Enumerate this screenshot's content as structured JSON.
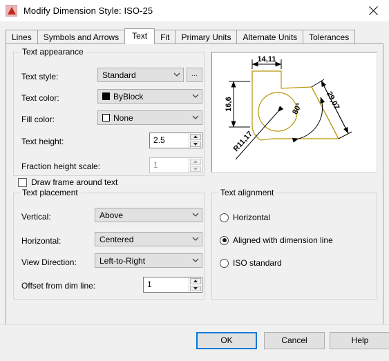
{
  "window": {
    "title": "Modify Dimension Style: ISO-25",
    "icon": "autocad-logo-icon",
    "close_label": "✕"
  },
  "tabs": [
    {
      "label": "Lines",
      "active": false
    },
    {
      "label": "Symbols and Arrows",
      "active": false
    },
    {
      "label": "Text",
      "active": true
    },
    {
      "label": "Fit",
      "active": false
    },
    {
      "label": "Primary Units",
      "active": false
    },
    {
      "label": "Alternate Units",
      "active": false
    },
    {
      "label": "Tolerances",
      "active": false
    }
  ],
  "text_appearance": {
    "legend": "Text appearance",
    "text_style": {
      "label": "Text style:",
      "value": "Standard",
      "browse_button": "...",
      "disabled": false
    },
    "text_color": {
      "label": "Text color:",
      "value": "ByBlock",
      "swatch": "#000000"
    },
    "fill_color": {
      "label": "Fill color:",
      "value": "None",
      "swatch": "#ffffff"
    },
    "text_height": {
      "label": "Text height:",
      "value": "2.5",
      "disabled": false
    },
    "fraction_height_scale": {
      "label": "Fraction height scale:",
      "value": "1",
      "disabled": true
    },
    "draw_frame": {
      "label": "Draw frame around text",
      "checked": false
    }
  },
  "text_placement": {
    "legend": "Text placement",
    "vertical": {
      "label": "Vertical:",
      "value": "Above"
    },
    "horizontal": {
      "label": "Horizontal:",
      "value": "Centered"
    },
    "view_direction": {
      "label": "View Direction:",
      "value": "Left-to-Right"
    },
    "offset": {
      "label": "Offset from dim line:",
      "value": "1"
    }
  },
  "text_alignment": {
    "legend": "Text alignment",
    "options": [
      {
        "label": "Horizontal",
        "checked": false
      },
      {
        "label": "Aligned with dimension line",
        "checked": true
      },
      {
        "label": "ISO standard",
        "checked": false
      }
    ]
  },
  "preview": {
    "name": "dimension-style-preview",
    "geometry_color": "#b8960b",
    "dimension_color": "#000000",
    "labels": {
      "width": "14,11",
      "height": "16,6",
      "diagonal": "29,07",
      "radius": "R11,17",
      "angle": "80°"
    }
  },
  "footer": {
    "ok": "OK",
    "cancel": "Cancel",
    "help": "Help"
  }
}
